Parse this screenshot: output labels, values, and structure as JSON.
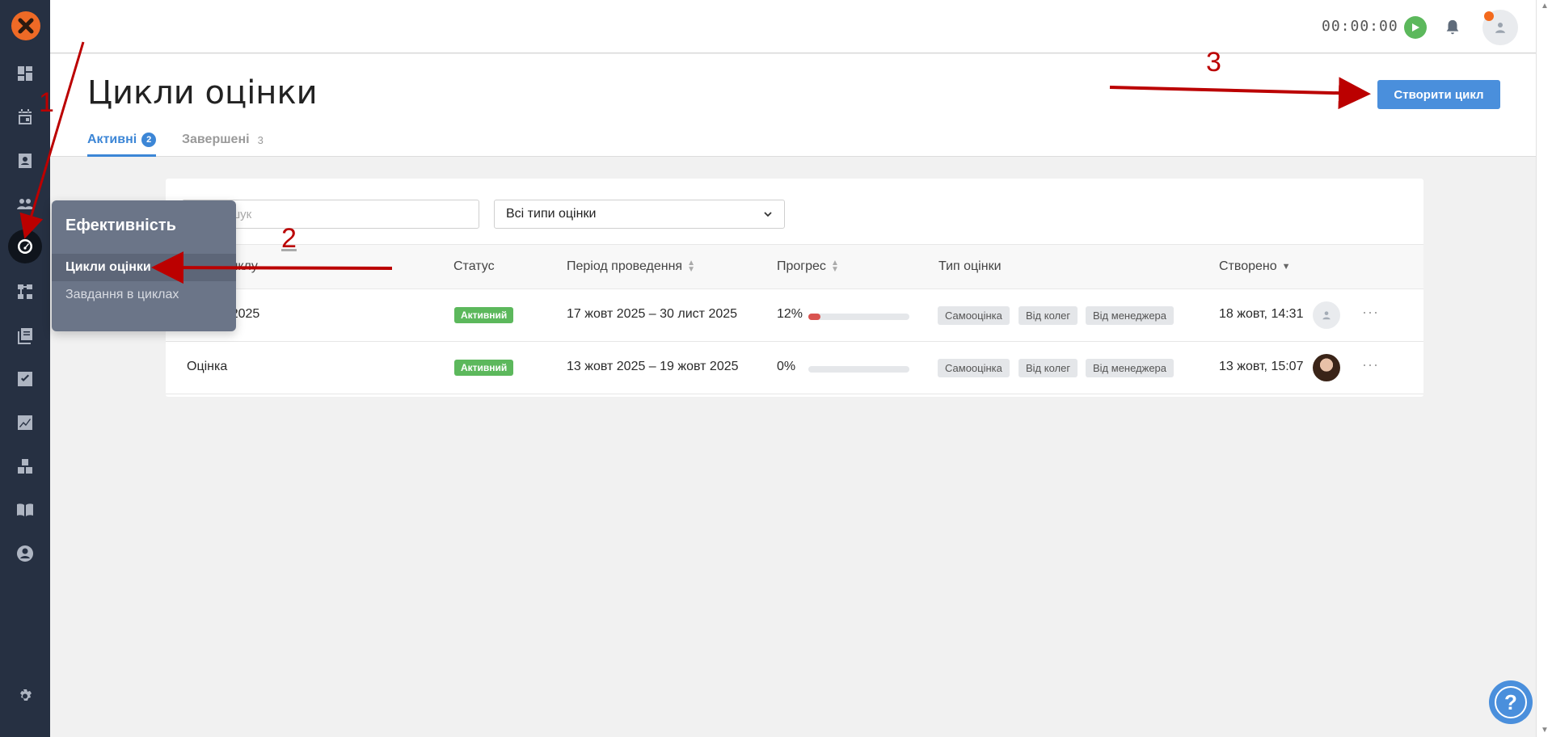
{
  "header": {
    "timer": "00:00:00",
    "icons": [
      "play-icon",
      "bell-icon",
      "user-icon"
    ]
  },
  "sidebar": {
    "icons": [
      "dashboard-icon",
      "calendar-icon",
      "contacts-icon",
      "people-icon",
      "performance-icon",
      "structure-icon",
      "library-icon",
      "checklist-icon",
      "chart-icon",
      "boxes-icon",
      "book-icon",
      "account-icon",
      "settings-icon"
    ]
  },
  "flyout": {
    "title": "Ефективність",
    "items": [
      {
        "label": "Цикли оцінки"
      },
      {
        "label": "Завдання в циклах"
      }
    ]
  },
  "page": {
    "title": "Цикли оцінки",
    "create_button": "Створити цикл",
    "tabs": [
      {
        "label": "Активні",
        "count": "2"
      },
      {
        "label": "Завершені",
        "count": "3"
      }
    ]
  },
  "filters": {
    "search_placeholder": "Пошук",
    "type_select": "Всі типи оцінки"
  },
  "table": {
    "columns": [
      "Назва циклу",
      "Статус",
      "Період проведення",
      "Прогрес",
      "Тип оцінки",
      "Створено"
    ],
    "rows": [
      {
        "name": "Оцінка 2025",
        "status": "Активний",
        "period": "17 жовт 2025 – 30 лист 2025",
        "progress_label": "12%",
        "progress": 0.12,
        "types": [
          "Самооцінка",
          "Від колег",
          "Від менеджера"
        ],
        "created": "18 жовт, 14:31",
        "more": "···"
      },
      {
        "name": "Оцінка",
        "status": "Активний",
        "period": "13 жовт 2025 – 19 жовт 2025",
        "progress_label": "0%",
        "progress": 0,
        "types": [
          "Самооцінка",
          "Від колег",
          "Від менеджера"
        ],
        "created": "13 жовт, 15:07",
        "more": "···"
      }
    ]
  },
  "annotations": {
    "step1": "1",
    "step2": "2",
    "step3": "3"
  },
  "help": {
    "label": "?"
  },
  "colors": {
    "accent": "#4a8fdc",
    "status_active": "#5cb85c",
    "sidebar": "#263042",
    "logo": "#ee6a26",
    "annotation": "#b00000"
  }
}
